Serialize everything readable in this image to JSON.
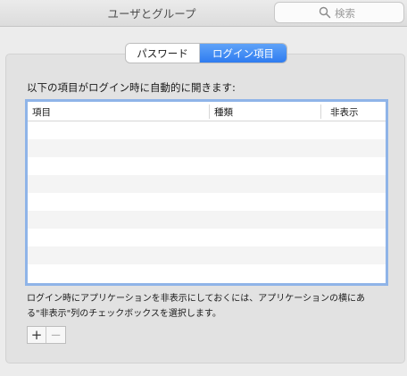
{
  "window": {
    "title": "ユーザとグループ"
  },
  "search": {
    "placeholder": "検索"
  },
  "tabs": [
    {
      "label": "パスワード",
      "selected": false
    },
    {
      "label": "ログイン項目",
      "selected": true
    }
  ],
  "login_items": {
    "heading": "以下の項目がログイン時に自動的に開きます:",
    "columns": {
      "item": "項目",
      "type": "種類",
      "hidden": "非表示"
    },
    "rows": [],
    "note": "ログイン時にアプリケーションを非表示にしておくには、アプリケーションの横にある\"非表示\"列のチェックボックスを選択します。",
    "buttons": {
      "add": "+",
      "remove": "−"
    }
  },
  "colors": {
    "accent": "#2f7cf0",
    "focus_ring": "#8fb4e8"
  }
}
